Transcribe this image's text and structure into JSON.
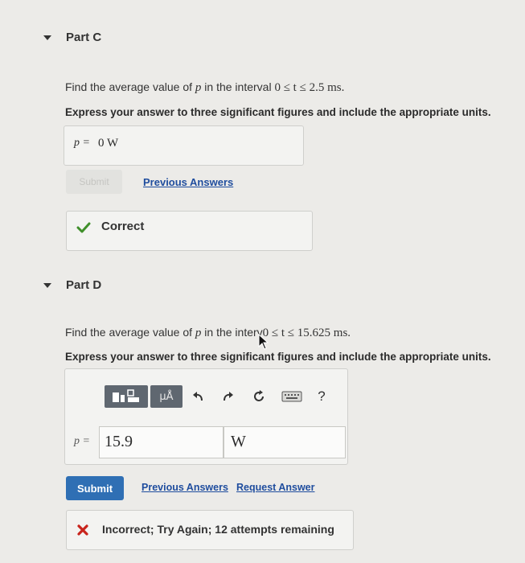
{
  "part_c": {
    "title": "Part C",
    "question_prefix": "Find the average value of",
    "var": "p",
    "question_mid": "in the interval",
    "interval": "0 ≤ t ≤ 2.5 ms.",
    "instruction": "Express your answer to three significant figures and include the appropriate units.",
    "answer_label": "p =",
    "answer_value": "0 W",
    "submit_label": "Submit",
    "previous_answers_label": "Previous Answers",
    "feedback": "Correct"
  },
  "part_d": {
    "title": "Part D",
    "question_prefix": "Find the average value of",
    "var": "p",
    "question_mid": "in the interv",
    "interval": "0 ≤ t ≤ 15.625 ms.",
    "instruction": "Express your answer to three significant figures and include the appropriate units.",
    "toolbar": {
      "units_label": "μÅ",
      "help_label": "?"
    },
    "answer_label": "p =",
    "value_input": "15.9",
    "unit_input": "W",
    "submit_label": "Submit",
    "previous_answers_label": "Previous Answers",
    "request_answer_label": "Request Answer",
    "feedback": "Incorrect; Try Again; 12 attempts remaining"
  },
  "colors": {
    "correct": "#3f8f2a",
    "incorrect": "#c8241c",
    "link": "#1f4d9e",
    "submit": "#2f6fb4"
  }
}
